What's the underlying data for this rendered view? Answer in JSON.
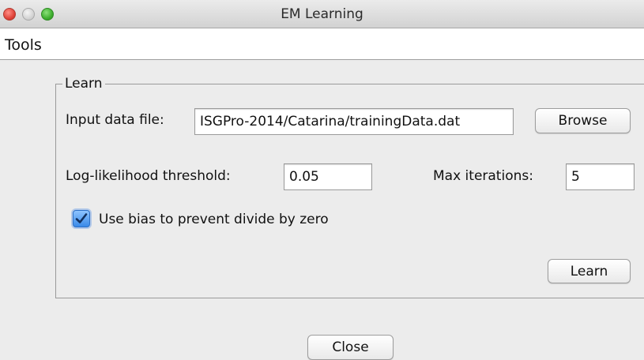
{
  "window": {
    "title": "EM Learning"
  },
  "menubar": {
    "items": [
      "Tools"
    ]
  },
  "learn_group": {
    "legend": "Learn",
    "input_file_label": "Input data file:",
    "input_file_value": "ISGPro-2014/Catarina/trainingData.dat",
    "browse_label": "Browse",
    "threshold_label": "Log-likelihood threshold:",
    "threshold_value": "0.05",
    "max_iter_label": "Max iterations:",
    "max_iter_value": "5",
    "bias_label": "Use bias to prevent divide by zero",
    "bias_checked": true,
    "learn_label": "Learn"
  },
  "footer": {
    "close_label": "Close"
  },
  "icons": {
    "window_close": "close-dot-icon",
    "window_minimize": "minimize-dot-icon",
    "window_zoom": "zoom-dot-icon",
    "checkbox": "checkmark-icon"
  },
  "colors": {
    "accent": "#3a8ae8",
    "window_bg": "#ececec",
    "close_dot": "#e0443a",
    "zoom_dot": "#3fae2f"
  }
}
